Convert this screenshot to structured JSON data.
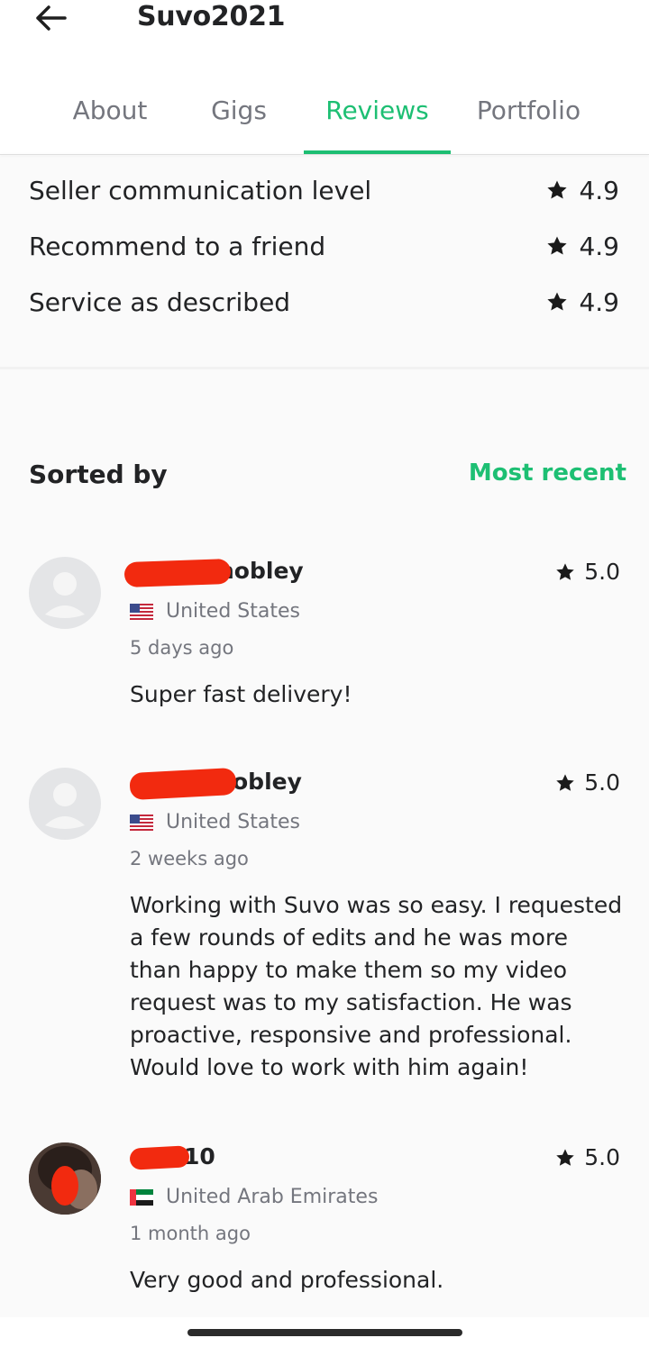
{
  "header": {
    "title": "Suvo2021",
    "back_icon": "arrow-left-icon"
  },
  "tabs": [
    {
      "label": "About",
      "active": false
    },
    {
      "label": "Gigs",
      "active": false
    },
    {
      "label": "Reviews",
      "active": true
    },
    {
      "label": "Portfolio",
      "active": false
    }
  ],
  "ratings": [
    {
      "label": "Seller communication level",
      "value": "4.9"
    },
    {
      "label": "Recommend to a friend",
      "value": "4.9"
    },
    {
      "label": "Service as described",
      "value": "4.9"
    }
  ],
  "sort": {
    "label": "Sorted by",
    "value": "Most recent"
  },
  "reviews": [
    {
      "name_visible": "nobley",
      "country": "United States",
      "flag": "us-flag-icon",
      "time": "5 days ago",
      "rating": "5.0",
      "text": "Super fast delivery!"
    },
    {
      "name_visible": "obley",
      "country": "United States",
      "flag": "us-flag-icon",
      "time": "2 weeks ago",
      "rating": "5.0",
      "text": "Working with Suvo was so easy. I requested a few rounds of edits and he was more than happy to make them so my video request was to my satisfaction. He was proactive, responsive and professional. Would love to work with him again!"
    },
    {
      "name_visible": "10",
      "country": "United Arab Emirates",
      "flag": "uae-flag-icon",
      "time": "1 month ago",
      "rating": "5.0",
      "text": "Very good and professional."
    }
  ],
  "colors": {
    "accent": "#1dbf73",
    "text": "#222325",
    "muted": "#74767e",
    "redaction": "#f22a0f"
  }
}
